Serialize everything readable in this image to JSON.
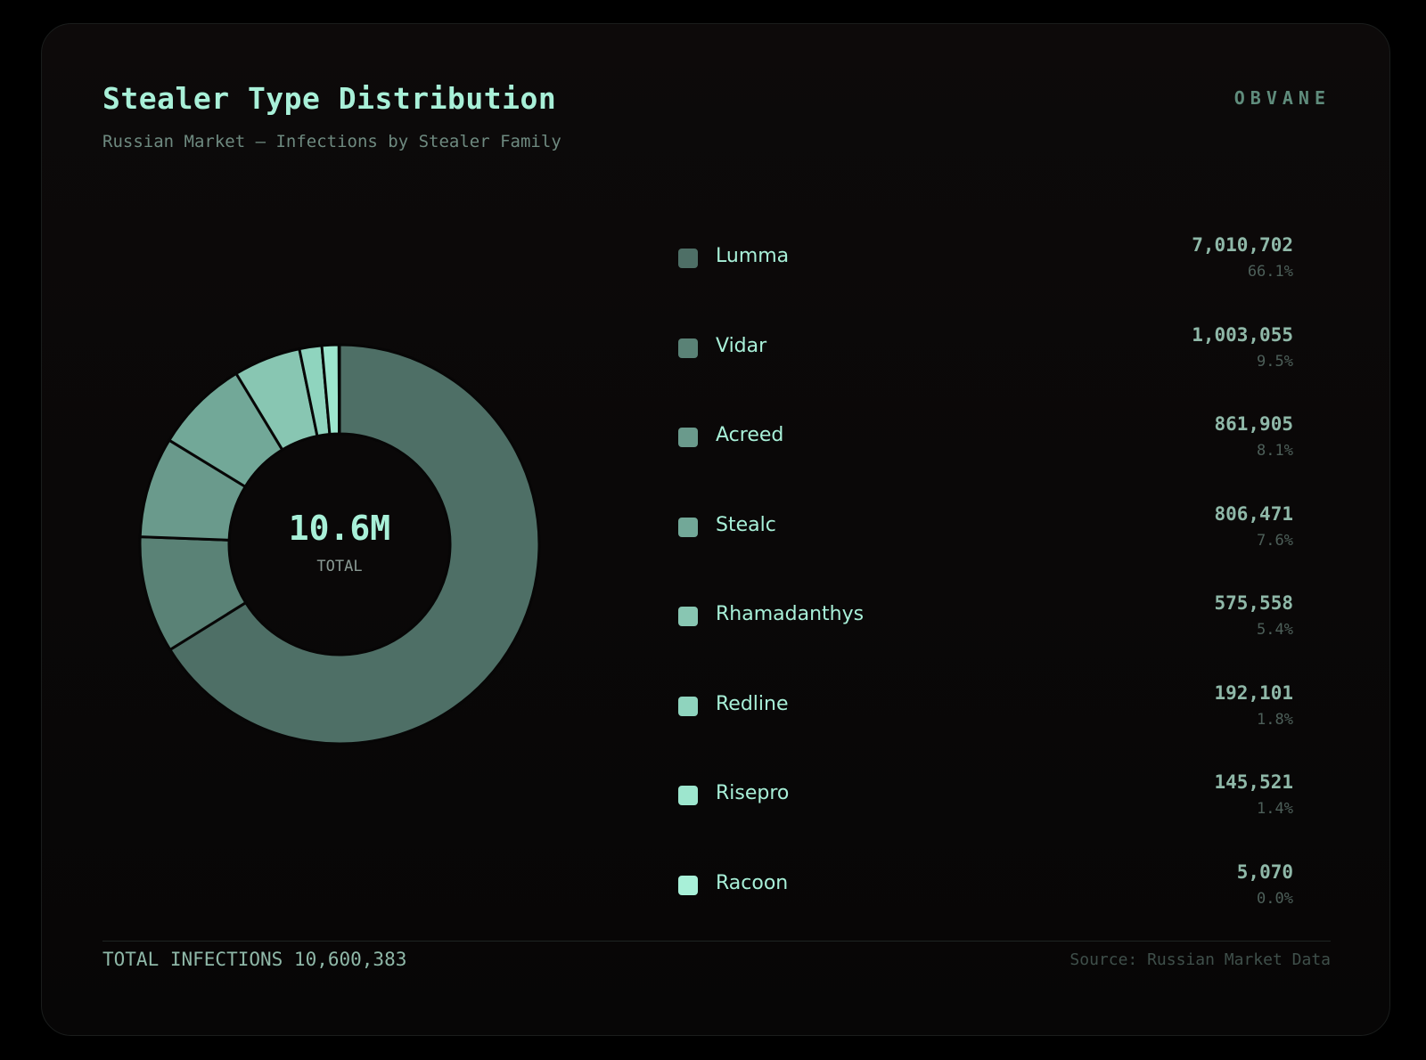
{
  "header": {
    "title": "Stealer Type Distribution",
    "subtitle": "Russian Market — Infections by Stealer Family",
    "brand": "OBVANE"
  },
  "center": {
    "value": "10.6M",
    "label": "TOTAL"
  },
  "legend": [
    {
      "name": "Lumma",
      "value": "7,010,702",
      "pct": "66.1%",
      "color": "#4e6f66"
    },
    {
      "name": "Vidar",
      "value": "1,003,055",
      "pct": "9.5%",
      "color": "#5a8276"
    },
    {
      "name": "Acreed",
      "value": "861,905",
      "pct": "8.1%",
      "color": "#6a9a8c"
    },
    {
      "name": "Stealc",
      "value": "806,471",
      "pct": "7.6%",
      "color": "#72a898"
    },
    {
      "name": "Rhamadanthys",
      "value": "575,558",
      "pct": "5.4%",
      "color": "#88c6b2"
    },
    {
      "name": "Redline",
      "value": "192,101",
      "pct": "1.8%",
      "color": "#8fd4be"
    },
    {
      "name": "Risepro",
      "value": "145,521",
      "pct": "1.4%",
      "color": "#9de6ce"
    },
    {
      "name": "Racoon",
      "value": "5,070",
      "pct": "0.0%",
      "color": "#a8f0d8"
    }
  ],
  "footer": {
    "total": "TOTAL INFECTIONS 10,600,383",
    "source": "Source: Russian Market Data"
  },
  "chart_data": {
    "type": "pie",
    "title": "Stealer Type Distribution",
    "subtitle": "Russian Market — Infections by Stealer Family",
    "categories": [
      "Lumma",
      "Vidar",
      "Acreed",
      "Stealc",
      "Rhamadanthys",
      "Redline",
      "Risepro",
      "Racoon"
    ],
    "values": [
      7010702,
      1003055,
      861905,
      806471,
      575558,
      192101,
      145521,
      5070
    ],
    "percentages": [
      66.1,
      9.5,
      8.1,
      7.6,
      5.4,
      1.8,
      1.4,
      0.0
    ],
    "colors": [
      "#4e6f66",
      "#5a8276",
      "#6a9a8c",
      "#72a898",
      "#88c6b2",
      "#8fd4be",
      "#9de6ce",
      "#a8f0d8"
    ],
    "donut": true,
    "center_text": "10.6M",
    "center_label": "TOTAL",
    "legend_position": "right"
  }
}
